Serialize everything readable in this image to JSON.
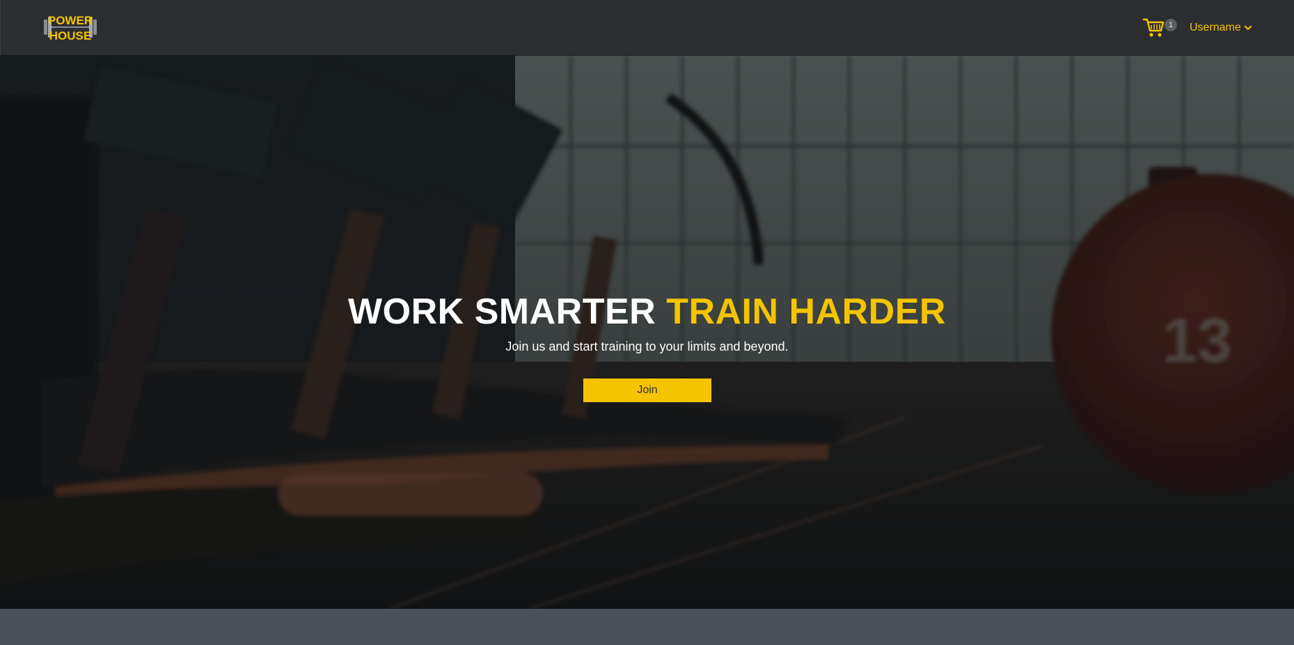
{
  "brand": {
    "logo_line1": "POWER",
    "logo_line2": "HOUSE",
    "accent_color": "#f5c400",
    "nav_bg": "#2b2d31"
  },
  "navbar": {
    "cart_icon": "shopping-cart-icon",
    "cart_count": "1",
    "user_label": "Username",
    "user_dropdown_icon": "chevron-down-icon"
  },
  "hero": {
    "title_part1": "WORK SMARTER",
    "title_part2": "TRAIN HARDER",
    "subtitle": "Join us and start training to your limits and beyond.",
    "cta_label": "Join",
    "background_image": "gym-treadmills-photo",
    "ball_label": "13"
  }
}
